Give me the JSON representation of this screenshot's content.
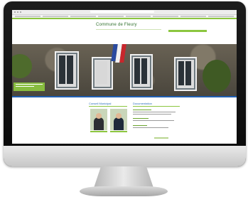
{
  "site": {
    "title": "Commune de Fleury"
  },
  "hero": {
    "description": "Mairie building facade with flags"
  },
  "columns": {
    "left_title": "Conseil Municipal",
    "right_title": "Documentation"
  },
  "colors": {
    "accent_green": "#8cc63f",
    "link_blue": "#2a6ebb",
    "bar_blue": "#1f5fb2"
  }
}
